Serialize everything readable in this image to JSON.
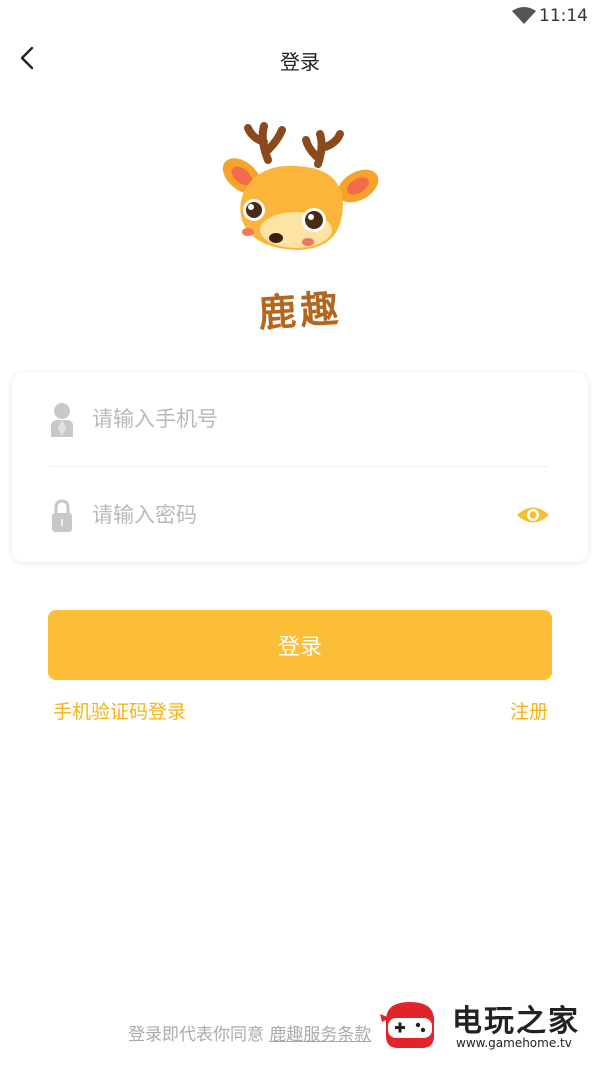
{
  "status_bar": {
    "time": "11:14",
    "wifi_icon": "wifi-icon"
  },
  "nav": {
    "title": "登录",
    "back_icon": "chevron-left-icon"
  },
  "logo": {
    "text": "鹿趣",
    "icon": "deer-mascot-icon"
  },
  "form": {
    "phone_placeholder": "请输入手机号",
    "phone_value": "",
    "password_placeholder": "请输入密码",
    "password_value": "",
    "phone_icon": "user-icon",
    "password_icon": "lock-icon",
    "visibility_icon": "eye-icon"
  },
  "actions": {
    "login_label": "登录",
    "sms_login_label": "手机验证码登录",
    "register_label": "注册"
  },
  "agreement": {
    "prefix": "登录即代表你同意 ",
    "terms_label": "鹿趣服务条款"
  },
  "watermark": {
    "name": "电玩之家",
    "url": "www.gamehome.tv"
  },
  "colors": {
    "accent": "#fbbe36",
    "link": "#f5b21a",
    "logo_text": "#b5661e",
    "placeholder": "#b9b9b9"
  }
}
